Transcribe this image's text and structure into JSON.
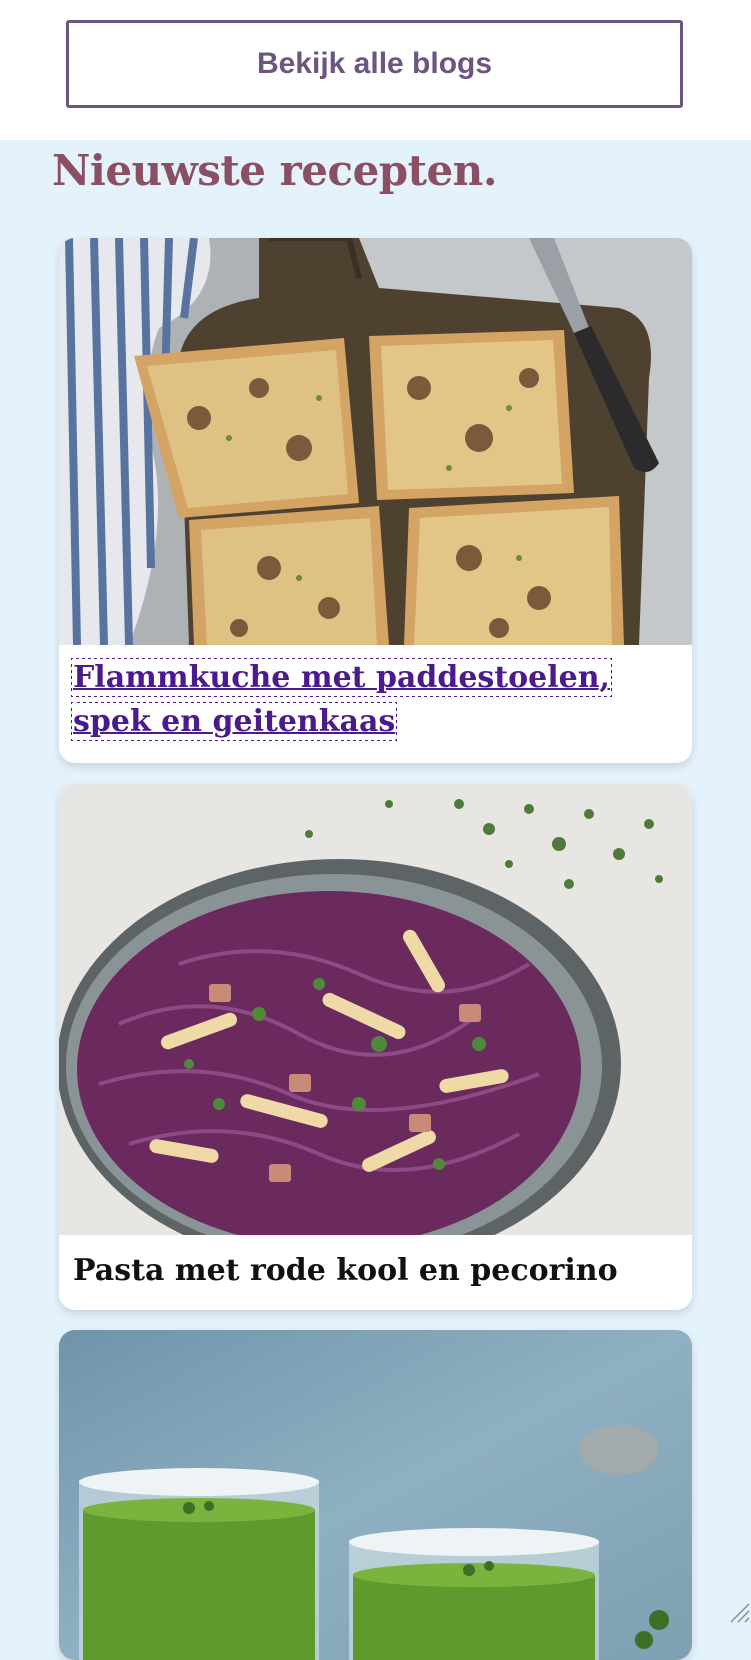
{
  "header": {
    "blogs_button_label": "Bekijk alle blogs"
  },
  "recipes_section": {
    "title": "Nieuwste recepten.",
    "cards": [
      {
        "title": "Flammkuche met paddestoelen, spek en geitenkaas",
        "image": "flammkuchen-photo"
      },
      {
        "title": "Pasta met rode kool en pecorino",
        "image": "red-cabbage-pasta-salad-photo"
      },
      {
        "title": "",
        "image": "green-smoothie-glasses-photo"
      }
    ]
  },
  "colors": {
    "page_background": "#e4f2fc",
    "button_accent": "#6e5580",
    "section_title": "#8b4f64",
    "link_visited": "#4b1a8c",
    "card_title": "#111111"
  },
  "icons": {
    "resize_grip": "resize-grip-icon"
  }
}
